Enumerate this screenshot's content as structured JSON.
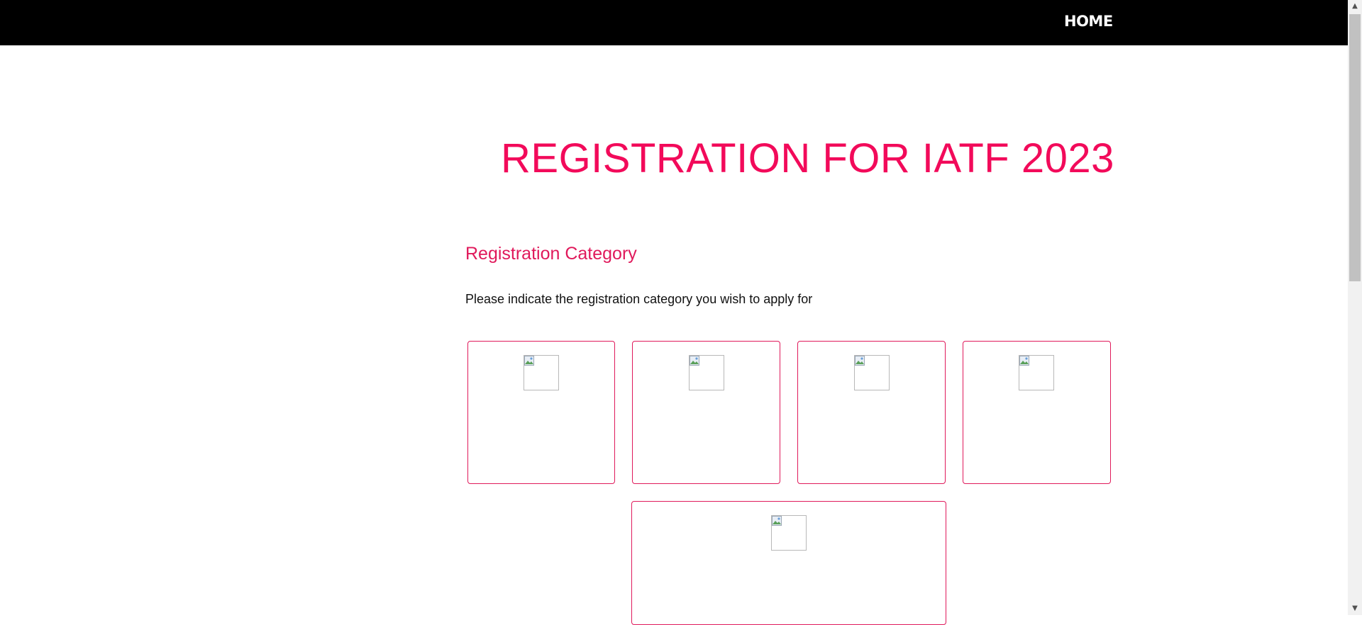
{
  "nav": {
    "home_label": "HOME"
  },
  "main": {
    "title": "REGISTRATION FOR IATF 2023",
    "section_heading": "Registration Category",
    "instruction": "Please indicate the registration category you wish to apply for",
    "category_cards_count": 5
  },
  "colors": {
    "accent": "#e0195b",
    "topbar": "#000000"
  },
  "icons": {
    "card_image": "broken-image-icon",
    "scroll_up": "scroll-up-arrow",
    "scroll_down": "scroll-down-arrow"
  }
}
